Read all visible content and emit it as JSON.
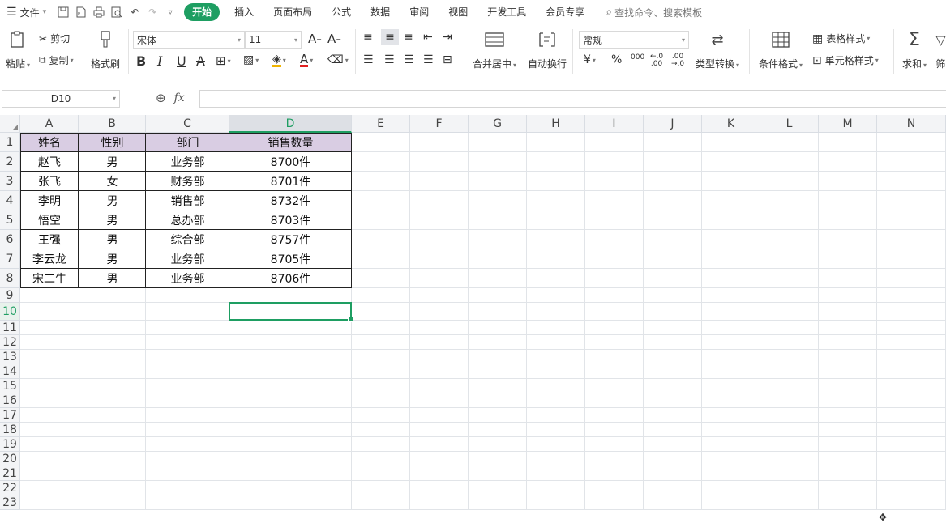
{
  "menubar": {
    "file": "文件",
    "tabs": [
      "开始",
      "插入",
      "页面布局",
      "公式",
      "数据",
      "审阅",
      "视图",
      "开发工具",
      "会员专享"
    ],
    "search_placeholder": "查找命令、搜索模板"
  },
  "ribbon": {
    "paste": "粘贴",
    "cut": "剪切",
    "copy": "复制",
    "format_painter": "格式刷",
    "font_name": "宋体",
    "font_size": "11",
    "bold": "B",
    "italic": "I",
    "underline": "U",
    "strike": "A",
    "merge_center": "合并居中",
    "wrap_text": "自动换行",
    "number_format": "常规",
    "currency": "¥",
    "percent": "%",
    "thousands": "000",
    "dec_increase": ".00",
    "dec_decrease": ".0",
    "type_convert": "类型转换",
    "conditional_format": "条件格式",
    "table_style": "表格样式",
    "cell_style": "单元格样式",
    "sum": "求和",
    "filter": "筛"
  },
  "formula_bar": {
    "name_box": "D10",
    "fx": "fx",
    "formula": ""
  },
  "sheet": {
    "columns": [
      "A",
      "B",
      "C",
      "D",
      "E",
      "F",
      "G",
      "H",
      "I",
      "J",
      "K",
      "L",
      "M",
      "N"
    ],
    "rows": [
      "1",
      "2",
      "3",
      "4",
      "5",
      "6",
      "7",
      "8",
      "9",
      "10",
      "11",
      "12",
      "13",
      "14",
      "15",
      "16",
      "17",
      "18",
      "19",
      "20",
      "21",
      "22",
      "23"
    ],
    "selected_column": "D",
    "selected_row": "10",
    "header": [
      "姓名",
      "性别",
      "部门",
      "销售数量"
    ],
    "data": [
      [
        "赵飞",
        "男",
        "业务部",
        "8700件"
      ],
      [
        "张飞",
        "女",
        "财务部",
        "8701件"
      ],
      [
        "李明",
        "男",
        "销售部",
        "8732件"
      ],
      [
        "悟空",
        "男",
        "总办部",
        "8703件"
      ],
      [
        "王强",
        "男",
        "综合部",
        "8757件"
      ],
      [
        "李云龙",
        "男",
        "业务部",
        "8705件"
      ],
      [
        "宋二牛",
        "男",
        "业务部",
        "8706件"
      ]
    ],
    "header_fill": "#d9cde3",
    "accent": "#1e9e62"
  }
}
